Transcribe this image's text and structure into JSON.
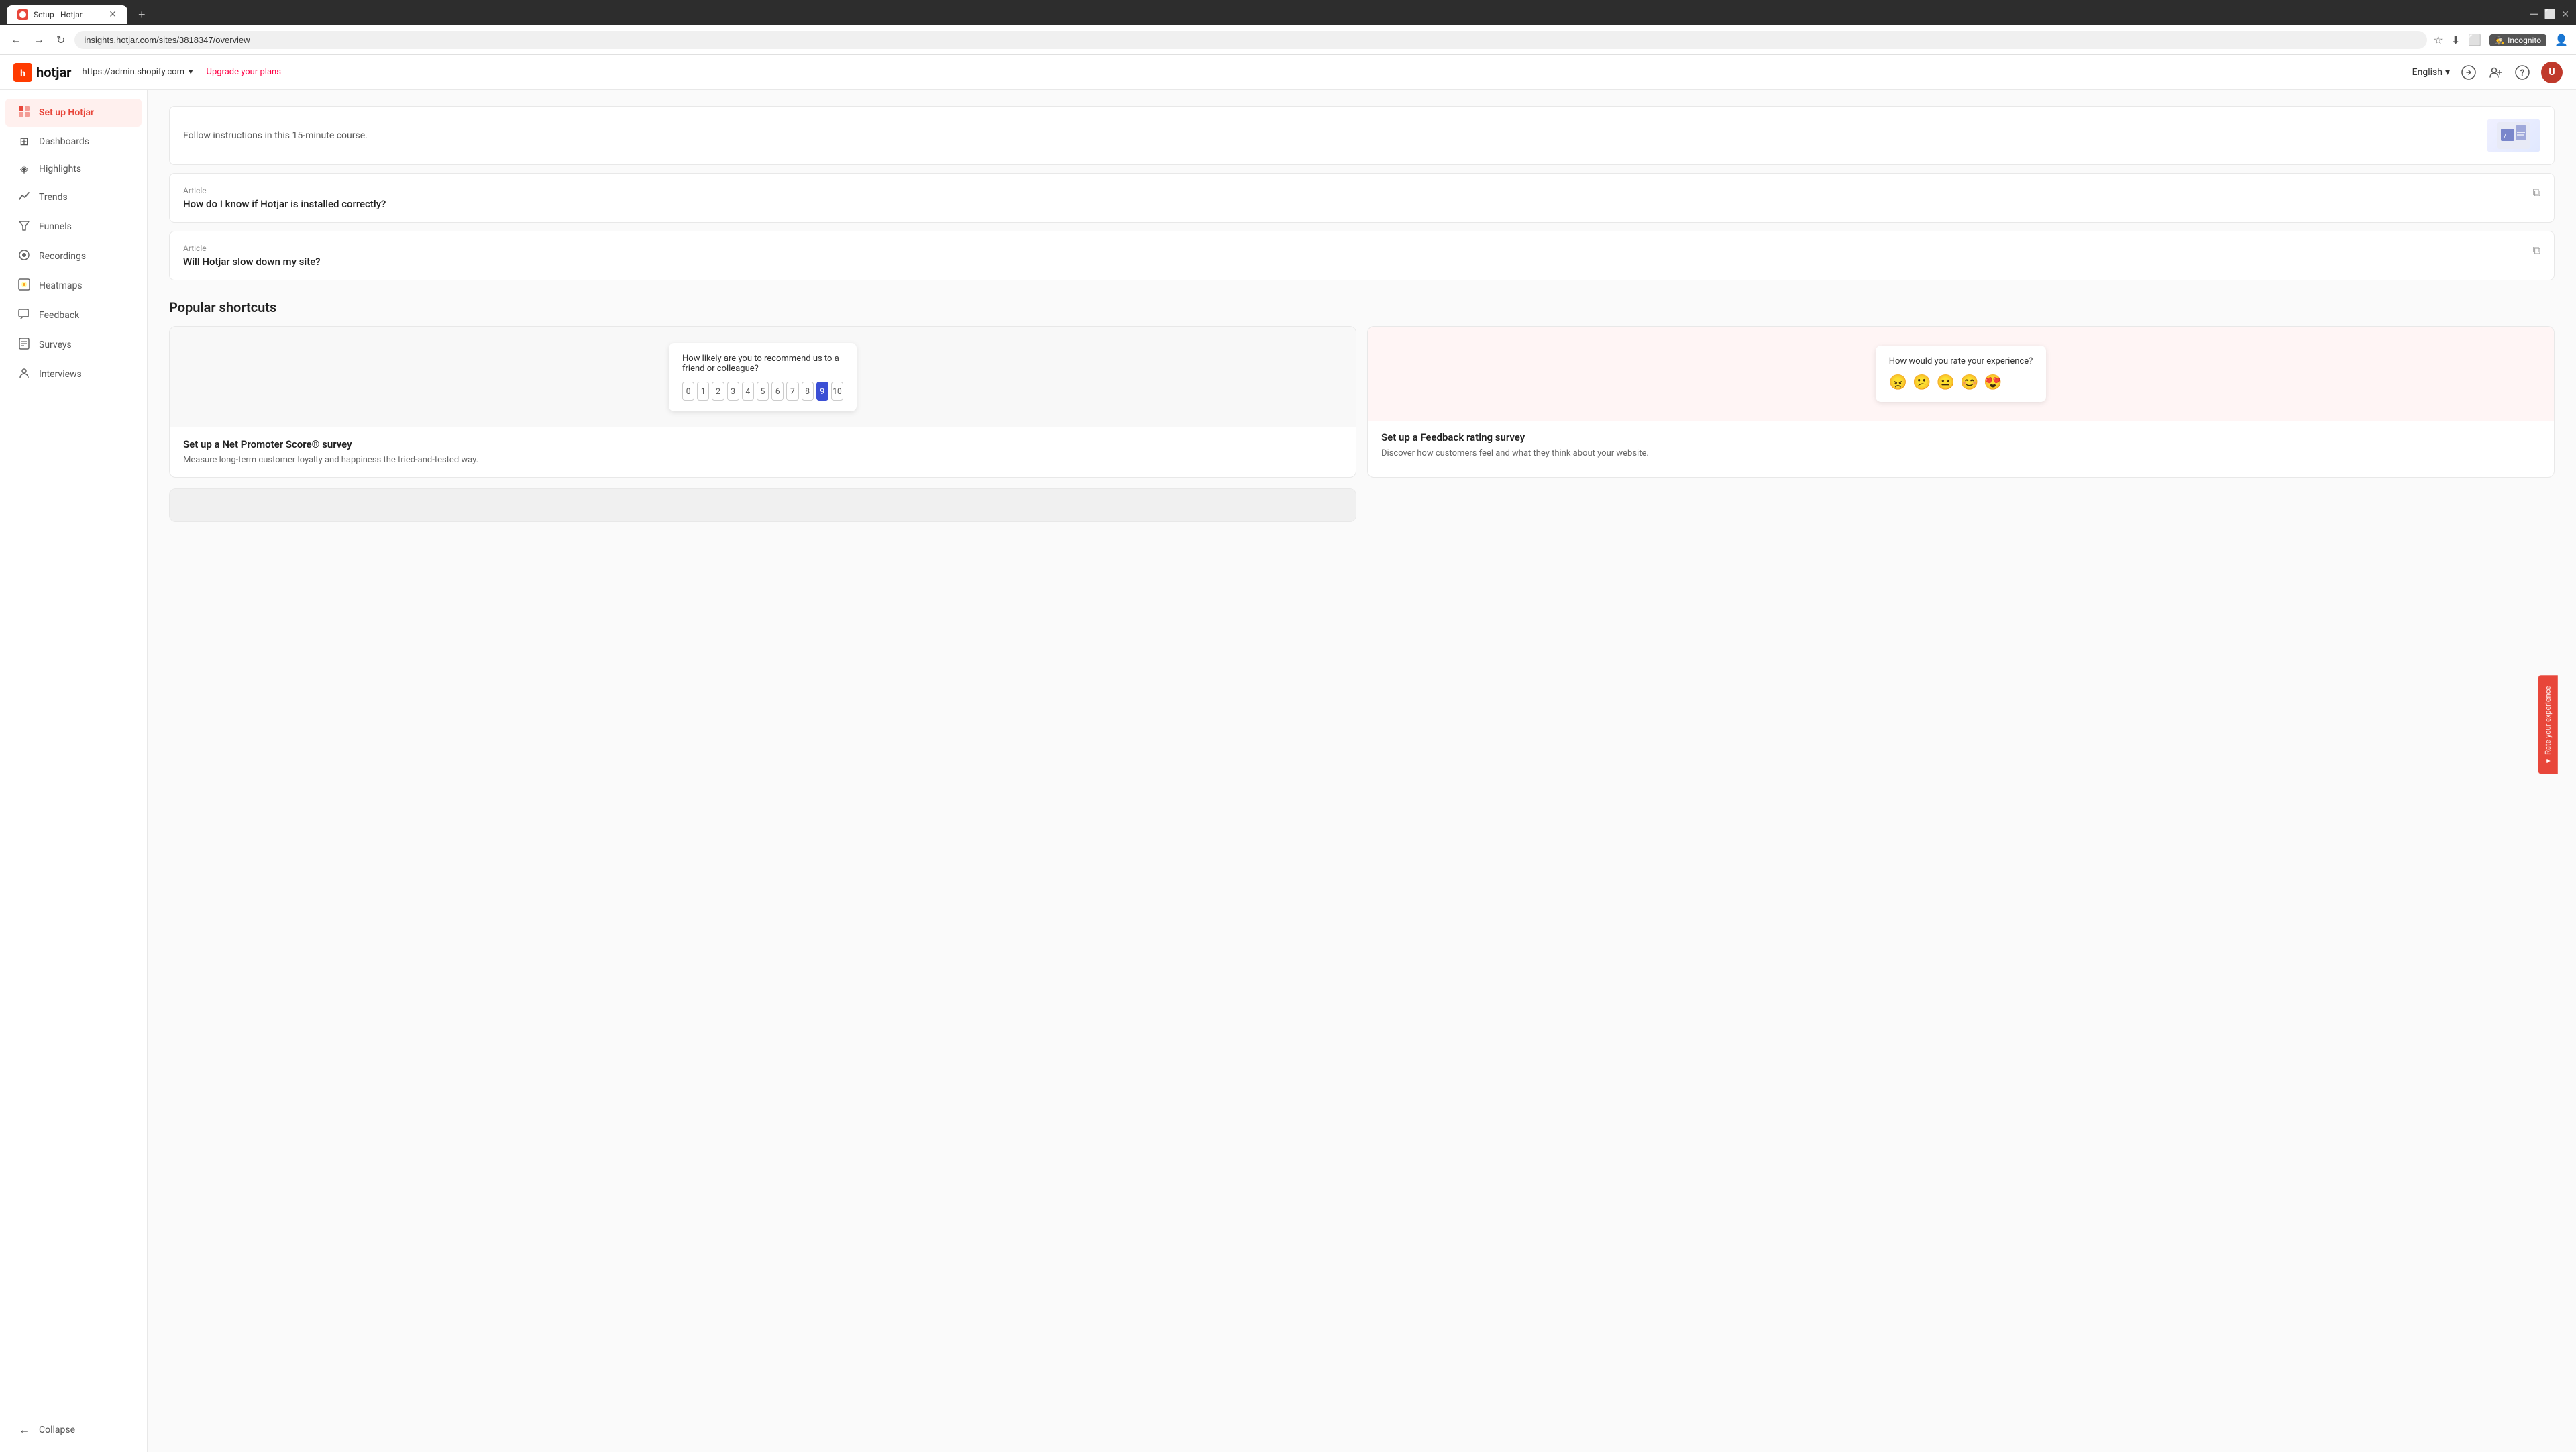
{
  "browser": {
    "tab_title": "Setup - Hotjar",
    "tab_new_label": "+",
    "url": "insights.hotjar.com/sites/3818347/overview",
    "nav_back": "←",
    "nav_forward": "→",
    "nav_refresh": "↻",
    "incognito_label": "Incognito",
    "bookmark_icon": "★",
    "download_icon": "⬇",
    "extensions_icon": "🧩",
    "user_icon": "👤"
  },
  "hotjar_header": {
    "logo_text": "hotjar",
    "site_url": "https://admin.shopify.com",
    "site_dropdown": "▾",
    "upgrade_link": "Upgrade your plans",
    "language": "English",
    "language_dropdown": "▾",
    "add_user_icon": "person-add",
    "help_icon": "?",
    "share_icon": "share"
  },
  "sidebar": {
    "setup_label": "Set up Hotjar",
    "items": [
      {
        "id": "dashboards",
        "label": "Dashboards",
        "icon": "⊞"
      },
      {
        "id": "highlights",
        "label": "Highlights",
        "icon": "◈"
      },
      {
        "id": "trends",
        "label": "Trends",
        "icon": "📈"
      },
      {
        "id": "funnels",
        "label": "Funnels",
        "icon": "⬦"
      },
      {
        "id": "recordings",
        "label": "Recordings",
        "icon": "⏺"
      },
      {
        "id": "heatmaps",
        "label": "Heatmaps",
        "icon": "🔥"
      },
      {
        "id": "feedback",
        "label": "Feedback",
        "icon": "💬"
      },
      {
        "id": "surveys",
        "label": "Surveys",
        "icon": "📋"
      },
      {
        "id": "interviews",
        "label": "Interviews",
        "icon": "🎙"
      }
    ],
    "collapse_label": "Collapse",
    "collapse_icon": "←"
  },
  "main": {
    "top_card_text": "Follow instructions in this 15-minute course.",
    "articles": [
      {
        "label": "Article",
        "title": "How do I know if Hotjar is installed correctly?",
        "link_icon": "⧉"
      },
      {
        "label": "Article",
        "title": "Will Hotjar slow down my site?",
        "link_icon": "⧉"
      }
    ],
    "popular_shortcuts_title": "Popular shortcuts",
    "shortcuts": [
      {
        "id": "nps",
        "title": "Set up a Net Promoter Score® survey",
        "description": "Measure long-term customer loyalty and happiness the tried-and-tested way.",
        "preview_question": "How likely are you to recommend us to a friend or colleague?",
        "nps_numbers": [
          "0",
          "1",
          "2",
          "3",
          "4",
          "5",
          "6",
          "7",
          "8",
          "9",
          "10"
        ],
        "nps_selected": 9
      },
      {
        "id": "feedback-rating",
        "title": "Set up a Feedback rating survey",
        "description": "Discover how customers feel and what they think about your website.",
        "preview_question": "How would you rate your experience?",
        "emojis": [
          "😠",
          "😕",
          "😐",
          "😊",
          "😍"
        ]
      }
    ]
  },
  "rate_experience": {
    "label": "Rate your experience",
    "heart_icon": "♥"
  }
}
